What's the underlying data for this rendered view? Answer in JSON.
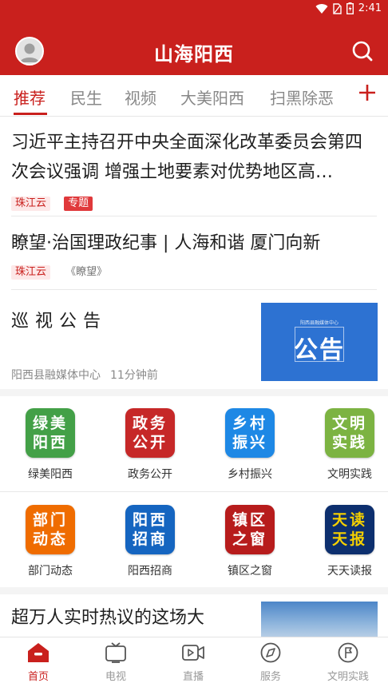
{
  "status_bar": {
    "time": "2:41"
  },
  "header": {
    "title": "山海阳西"
  },
  "tabs": [
    {
      "label": "推荐",
      "active": true
    },
    {
      "label": "民生"
    },
    {
      "label": "视频"
    },
    {
      "label": "大美阳西"
    },
    {
      "label": "扫黑除恶"
    }
  ],
  "news": [
    {
      "title": "习近平主持召开中央全面深化改革委员会第四次会议强调 增强土地要素对优势地区高…",
      "tags": [
        "珠江云",
        "专题"
      ]
    },
    {
      "title": "瞭望·治国理政纪事 | 人海和谐 厦门向新",
      "tags": [
        "珠江云",
        "《瞭望》"
      ]
    }
  ],
  "notice": {
    "title": "巡视公告",
    "source": "阳西县融媒体中心",
    "time": "11分钟前",
    "image_small_text": "阳西县融媒体中心",
    "image_text": "公告"
  },
  "services_row1": [
    {
      "label": "绿美阳西",
      "icon_text": [
        "绿美",
        "阳西"
      ],
      "color": "#43a047"
    },
    {
      "label": "政务公开",
      "icon_text": [
        "政务",
        "公开"
      ],
      "color": "#c62828"
    },
    {
      "label": "乡村振兴",
      "icon_text": [
        "乡村",
        "振兴"
      ],
      "color": "#1e88e5"
    },
    {
      "label": "文明实践",
      "icon_text": [
        "文明",
        "实践"
      ],
      "color": "#7cb342"
    }
  ],
  "services_row2": [
    {
      "label": "部门动态",
      "icon_text": [
        "部门",
        "动态"
      ],
      "color": "#ef6c00"
    },
    {
      "label": "阳西招商",
      "icon_text": [
        "阳西",
        "招商"
      ],
      "color": "#1565c0"
    },
    {
      "label": "镇区之窗",
      "icon_text": [
        "镇区",
        "之窗"
      ],
      "color": "#b71c1c"
    },
    {
      "label": "天天读报",
      "icon_text": [
        "天读",
        "天报"
      ],
      "color": "#0d2f6e"
    }
  ],
  "bottom_news": {
    "title": "超万人实时热议的这场大"
  },
  "nav": [
    {
      "label": "首页",
      "icon": "home-icon",
      "active": true
    },
    {
      "label": "电视",
      "icon": "tv-icon"
    },
    {
      "label": "直播",
      "icon": "video-camera-icon"
    },
    {
      "label": "服务",
      "icon": "compass-icon"
    },
    {
      "label": "文明实践",
      "icon": "flag-icon"
    }
  ],
  "colors": {
    "primary": "#c9201d",
    "tab_inactive": "#888888"
  }
}
